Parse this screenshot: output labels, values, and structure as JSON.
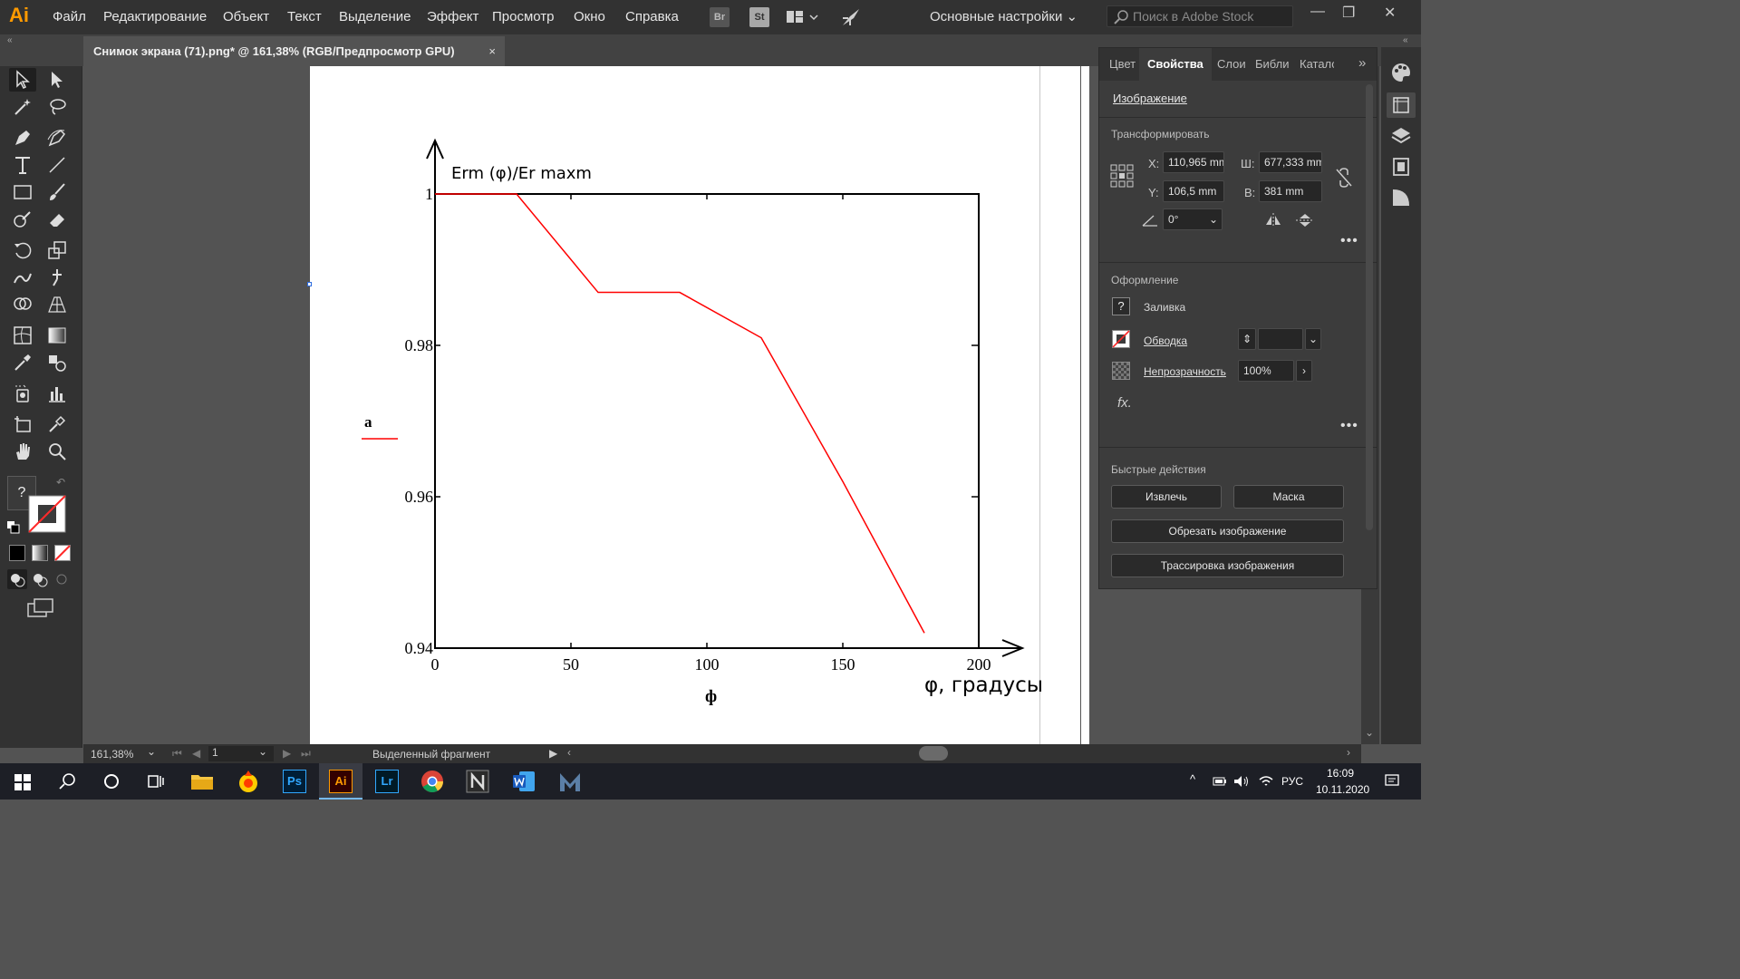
{
  "app": {
    "logo": "Ai",
    "workspace": "Основные настройки",
    "stock_placeholder": "Поиск в Adobe Stock"
  },
  "menu": [
    "Файл",
    "Редактирование",
    "Объект",
    "Текст",
    "Выделение",
    "Эффект",
    "Просмотр",
    "Окно",
    "Справка"
  ],
  "menubar_icons": {
    "bridge": "Br",
    "stock": "St"
  },
  "document": {
    "tab_title": "Снимок экрана (71).png* @ 161,38% (RGB/Предпросмотр GPU)",
    "close": "×"
  },
  "chart_data": {
    "type": "line",
    "ylabel": "Erm (φ)/Er maxm",
    "xlabel": "ф",
    "x_annotation": "φ, градусы",
    "legend": [
      {
        "name": "а",
        "color": "#ff0000"
      }
    ],
    "xlim": [
      0,
      200
    ],
    "ylim": [
      0.94,
      1
    ],
    "x_ticks": [
      "0",
      "50",
      "100",
      "150",
      "200"
    ],
    "y_ticks": [
      "0.94",
      "0.96",
      "0.98",
      "1"
    ],
    "series": [
      {
        "name": "а",
        "color": "#ff0000",
        "x": [
          0,
          30,
          60,
          90,
          120,
          150,
          180
        ],
        "y": [
          1,
          1,
          0.987,
          0.987,
          0.981,
          0.962,
          0.942
        ]
      }
    ]
  },
  "panel": {
    "tabs": [
      "Цвет",
      "Свойства",
      "Слои",
      "Библи",
      "Катало"
    ],
    "active_tab": "Свойства",
    "object_type": "Изображение",
    "transform": {
      "title": "Трансформировать",
      "x_label": "X:",
      "x": "110,965 mm",
      "y_label": "Y:",
      "y": "106,5 mm",
      "w_label": "Ш:",
      "w": "677,333 mm",
      "h_label": "В:",
      "h": "381 mm",
      "angle": "0°"
    },
    "appearance": {
      "title": "Оформление",
      "fill": "Заливка",
      "stroke": "Обводка",
      "opacity_label": "Непрозрачность",
      "opacity": "100%",
      "fx": "fx."
    },
    "quick_actions": {
      "title": "Быстрые действия",
      "extract": "Извлечь",
      "mask": "Маска",
      "crop": "Обрезать изображение",
      "trace": "Трассировка изображения"
    }
  },
  "status": {
    "zoom": "161,38%",
    "artboard": "1",
    "message": "Выделенный фрагмент"
  },
  "taskbar": {
    "language": "РУС",
    "time": "16:09",
    "date": "10.11.2020",
    "apps": [
      "Ps",
      "Ai",
      "Lr"
    ]
  },
  "colors": {
    "accent": "#ff9a00",
    "plot": "#ff0000"
  }
}
